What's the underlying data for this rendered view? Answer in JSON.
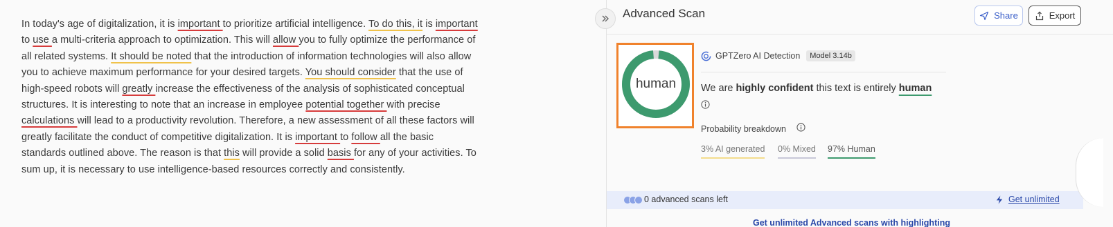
{
  "essay": {
    "segments": [
      {
        "text": "In today's age of digitalization, it is ",
        "mark": ""
      },
      {
        "text": "important ",
        "mark": "red"
      },
      {
        "text": "to prioritize artificial intelligence. ",
        "mark": ""
      },
      {
        "text": "To do this, it",
        "mark": "yellow"
      },
      {
        "text": " is ",
        "mark": ""
      },
      {
        "text": "important ",
        "mark": "red"
      },
      {
        "text": "to ",
        "mark": ""
      },
      {
        "text": "use ",
        "mark": "red"
      },
      {
        "text": "a multi-criteria approach to optimization. This will ",
        "mark": ""
      },
      {
        "text": "allow ",
        "mark": "red"
      },
      {
        "text": "you to fully optimize the performance of all related systems. ",
        "mark": ""
      },
      {
        "text": "It should be noted",
        "mark": "yellow"
      },
      {
        "text": " that the introduction of information technologies will also allow you to achieve maximum performance for your desired targets. ",
        "mark": ""
      },
      {
        "text": "You should consider",
        "mark": "yellow"
      },
      {
        "text": " that the use of high-speed robots will ",
        "mark": ""
      },
      {
        "text": "greatly ",
        "mark": "red"
      },
      {
        "text": "increase the effectiveness of the analysis of sophisticated conceptual structures. It is interesting to note that an increase in employee ",
        "mark": ""
      },
      {
        "text": "potential together ",
        "mark": "red"
      },
      {
        "text": "with precise ",
        "mark": ""
      },
      {
        "text": "calculations ",
        "mark": "red"
      },
      {
        "text": "will lead to a productivity revolution. Therefore, a new assessment of all these factors will greatly facilitate the conduct of competitive digitalization. It is ",
        "mark": ""
      },
      {
        "text": "important ",
        "mark": "red"
      },
      {
        "text": "to ",
        "mark": ""
      },
      {
        "text": "follow ",
        "mark": "red"
      },
      {
        "text": "all the basic standards outlined above. The reason is that ",
        "mark": ""
      },
      {
        "text": "this",
        "mark": "yellow"
      },
      {
        "text": " will provide a solid ",
        "mark": ""
      },
      {
        "text": "basis ",
        "mark": "red"
      },
      {
        "text": "for any of your activities. To sum up, it is necessary to use intelligence-based resources correctly and consistently.",
        "mark": ""
      }
    ]
  },
  "header": {
    "title": "Advanced Scan",
    "share_label": "Share",
    "export_label": "Export"
  },
  "result": {
    "donut_label": "human",
    "human_fraction": 0.97,
    "ai_fraction": 0.03,
    "detector_name": "GPTZero AI Detection",
    "model_badge": "Model 3.14b",
    "verdict_prefix": "We are ",
    "verdict_confidence": "highly confident",
    "verdict_middle": " this text is entirely ",
    "verdict_class": "human"
  },
  "probability": {
    "title": "Probability breakdown",
    "ai_label": "3% AI generated",
    "mixed_label": "0% Mixed",
    "human_label": "97% Human"
  },
  "scans": {
    "left_text": "0 advanced scans left",
    "unlimited_label": "Get unlimited",
    "cutoff_text": "Get unlimited Advanced scans with highlighting"
  },
  "colors": {
    "human_green": "#3d9a6e",
    "ai_gray": "#d9d9d9",
    "highlight_orange": "#f0822c",
    "link_blue": "#2947a8"
  }
}
